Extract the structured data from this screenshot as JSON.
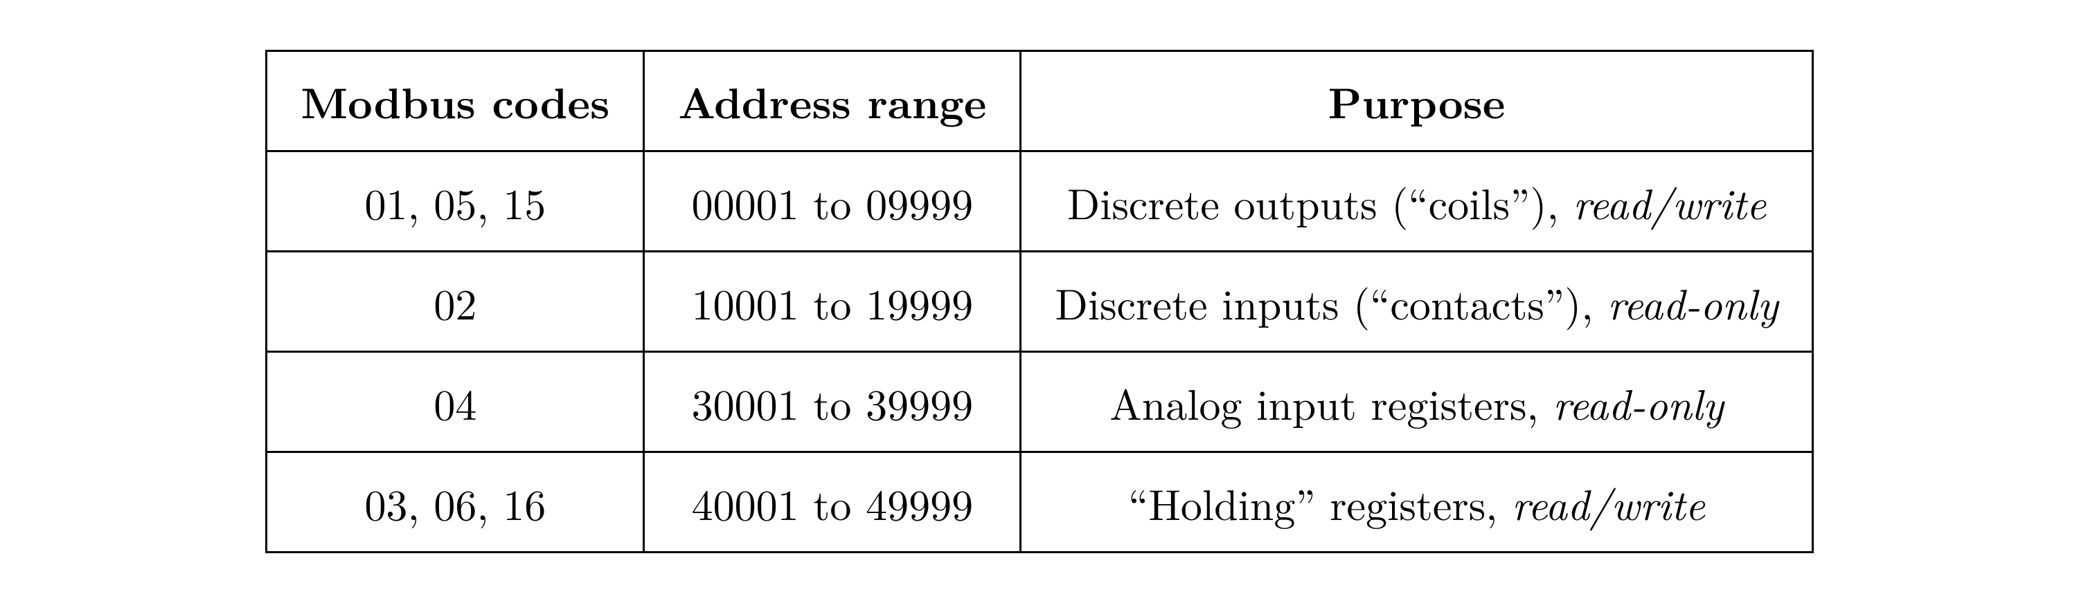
{
  "table": {
    "headers": [
      "Modbus codes",
      "Address range",
      "Purpose"
    ],
    "rows": [
      {
        "codes": "01, 05, 15",
        "range": "00001 to 09999",
        "purpose_plain": "Discrete outputs (“coils”), ",
        "purpose_ital": "read/write"
      },
      {
        "codes": "02",
        "range": "10001 to 19999",
        "purpose_plain": "Discrete inputs (“contacts”), ",
        "purpose_ital": "read-only"
      },
      {
        "codes": "04",
        "range": "30001 to 39999",
        "purpose_plain": "Analog input registers, ",
        "purpose_ital": "read-only"
      },
      {
        "codes": "03, 06, 16",
        "range": "40001 to 49999",
        "purpose_plain": "“Holding” registers, ",
        "purpose_ital": "read/write"
      }
    ]
  }
}
